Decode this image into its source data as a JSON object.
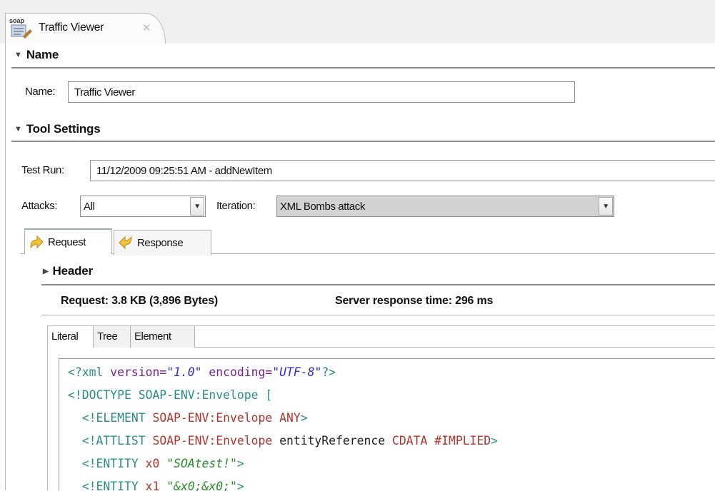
{
  "tab": {
    "label": "Traffic Viewer",
    "icon": "soap-tool-icon",
    "close_glyph": "✕"
  },
  "name_section": {
    "title": "Name",
    "field_label": "Name:",
    "field_value": "Traffic Viewer"
  },
  "tool_settings": {
    "title": "Tool Settings",
    "test_run_label": "Test Run:",
    "test_run_value": "11/12/2009 09:25:51 AM - addNewItem",
    "attacks_label": "Attacks:",
    "attacks_value": "All",
    "iteration_label": "Iteration:",
    "iteration_value": "XML Bombs attack"
  },
  "message_tabs": [
    {
      "label": "Request",
      "icon": "request-arrow-icon",
      "selected": true
    },
    {
      "label": "Response",
      "icon": "response-arrow-icon",
      "selected": false
    }
  ],
  "header_section": {
    "title": "Header"
  },
  "stats": {
    "request": "Request: 3.8 KB (3,896 Bytes)",
    "response_time": "Server response time: 296 ms"
  },
  "view_tabs": [
    "Literal",
    "Tree",
    "Element"
  ],
  "code_lines": [
    "<?xml version=\"1.0\" encoding=\"UTF-8\"?>",
    "<!DOCTYPE SOAP-ENV:Envelope [",
    "  <!ELEMENT SOAP-ENV:Envelope ANY>",
    "  <!ATTLIST SOAP-ENV:Envelope entityReference CDATA #IMPLIED>",
    "  <!ENTITY x0 \"SOAtest!\">",
    "  <!ENTITY x1 \"&x0;&x0;\">"
  ],
  "colors": {
    "syntax_punctuation": "#2a8c88",
    "syntax_attribute": "#7a1f8f",
    "syntax_value": "#2a2ad8",
    "syntax_name": "#b2342a",
    "syntax_entity": "#2a8c2a",
    "iteration_field_bg": "#d2d2d2"
  }
}
